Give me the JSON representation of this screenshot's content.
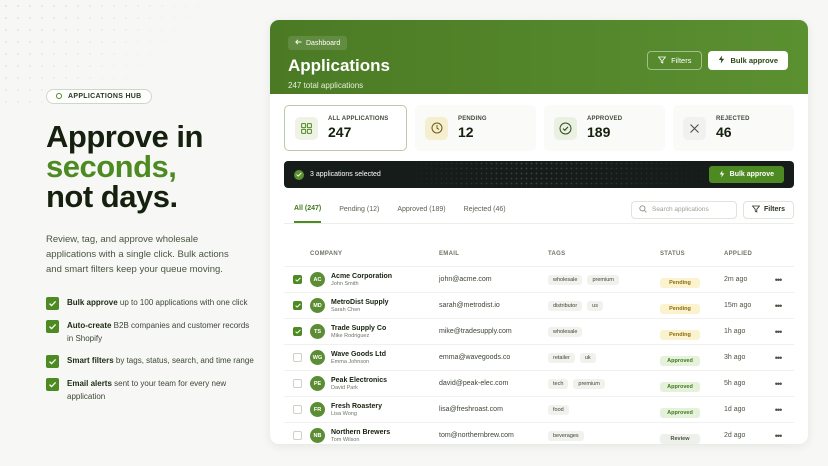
{
  "left": {
    "badge": "APPLICATIONS HUB",
    "headline_line1": "Approve in",
    "headline_accent": "seconds,",
    "headline_line3": "not days.",
    "subtext": "Review, tag, and approve wholesale applications with a single click. Bulk actions and smart filters keep your queue moving.",
    "features": [
      {
        "title": "Bulk approve",
        "text": " up to 100 applications with one click"
      },
      {
        "title": "Auto-create",
        "text": " B2B companies and customer records in Shopify"
      },
      {
        "title": "Smart filters",
        "text": " by tags, status, search, and time range"
      },
      {
        "title": "Email alerts",
        "text": " sent to your team for every new application"
      }
    ]
  },
  "header": {
    "back_label": "Dashboard",
    "title": "Applications",
    "subtitle": "247 total applications",
    "filters_label": "Filters",
    "bulk_label": "Bulk approve"
  },
  "stats": [
    {
      "label": "ALL APPLICATIONS",
      "value": "247",
      "icon": "grid-icon"
    },
    {
      "label": "PENDING",
      "value": "12",
      "icon": "clock-icon"
    },
    {
      "label": "APPROVED",
      "value": "189",
      "icon": "check-circle-icon"
    },
    {
      "label": "REJECTED",
      "value": "46",
      "icon": "x-icon"
    }
  ],
  "selection": {
    "text": "3 applications selected",
    "bulk_label": "Bulk approve"
  },
  "tabs": [
    "All (247)",
    "Pending (12)",
    "Approved (189)",
    "Rejected (46)"
  ],
  "search": {
    "placeholder": "Search applications"
  },
  "filters_label": "Filters",
  "table": {
    "headers": {
      "company": "COMPANY",
      "email": "EMAIL",
      "tags": "TAGS",
      "status": "STATUS",
      "applied": "APPLIED"
    },
    "rows": [
      {
        "checked": true,
        "initials": "AC",
        "company": "Acme Corporation",
        "contact": "John Smith",
        "email": "john@acme.com",
        "tags": [
          "wholesale",
          "premium"
        ],
        "status": "Pending",
        "applied": "2m ago"
      },
      {
        "checked": true,
        "initials": "MD",
        "company": "MetroDist Supply",
        "contact": "Sarah Chen",
        "email": "sarah@metrodist.io",
        "tags": [
          "distributor",
          "us"
        ],
        "status": "Pending",
        "applied": "15m ago"
      },
      {
        "checked": true,
        "initials": "TS",
        "company": "Trade Supply Co",
        "contact": "Mike Rodriguez",
        "email": "mike@tradesupply.com",
        "tags": [
          "wholesale"
        ],
        "status": "Pending",
        "applied": "1h ago"
      },
      {
        "checked": false,
        "initials": "WG",
        "company": "Wave Goods Ltd",
        "contact": "Emma Johnson",
        "email": "emma@wavegoods.co",
        "tags": [
          "retailer",
          "uk"
        ],
        "status": "Approved",
        "applied": "3h ago"
      },
      {
        "checked": false,
        "initials": "PE",
        "company": "Peak Electronics",
        "contact": "David Park",
        "email": "david@peak-elec.com",
        "tags": [
          "tech",
          "premium"
        ],
        "status": "Approved",
        "applied": "5h ago"
      },
      {
        "checked": false,
        "initials": "FR",
        "company": "Fresh Roastery",
        "contact": "Lisa Wong",
        "email": "lisa@freshroast.com",
        "tags": [
          "food"
        ],
        "status": "Approved",
        "applied": "1d ago"
      },
      {
        "checked": false,
        "initials": "NB",
        "company": "Northern Brewers",
        "contact": "Tom Wilson",
        "email": "tom@northernbrew.com",
        "tags": [
          "beverages"
        ],
        "status": "Review",
        "applied": "2d ago"
      }
    ]
  },
  "colors": {
    "brand": "#4e8a22",
    "pending_bg": "#fbf3cf",
    "pending_fg": "#8a6d0c",
    "approved_bg": "#e6f1dc",
    "approved_fg": "#3f7a19",
    "review_bg": "#eef0ec",
    "review_fg": "#4a5443"
  }
}
